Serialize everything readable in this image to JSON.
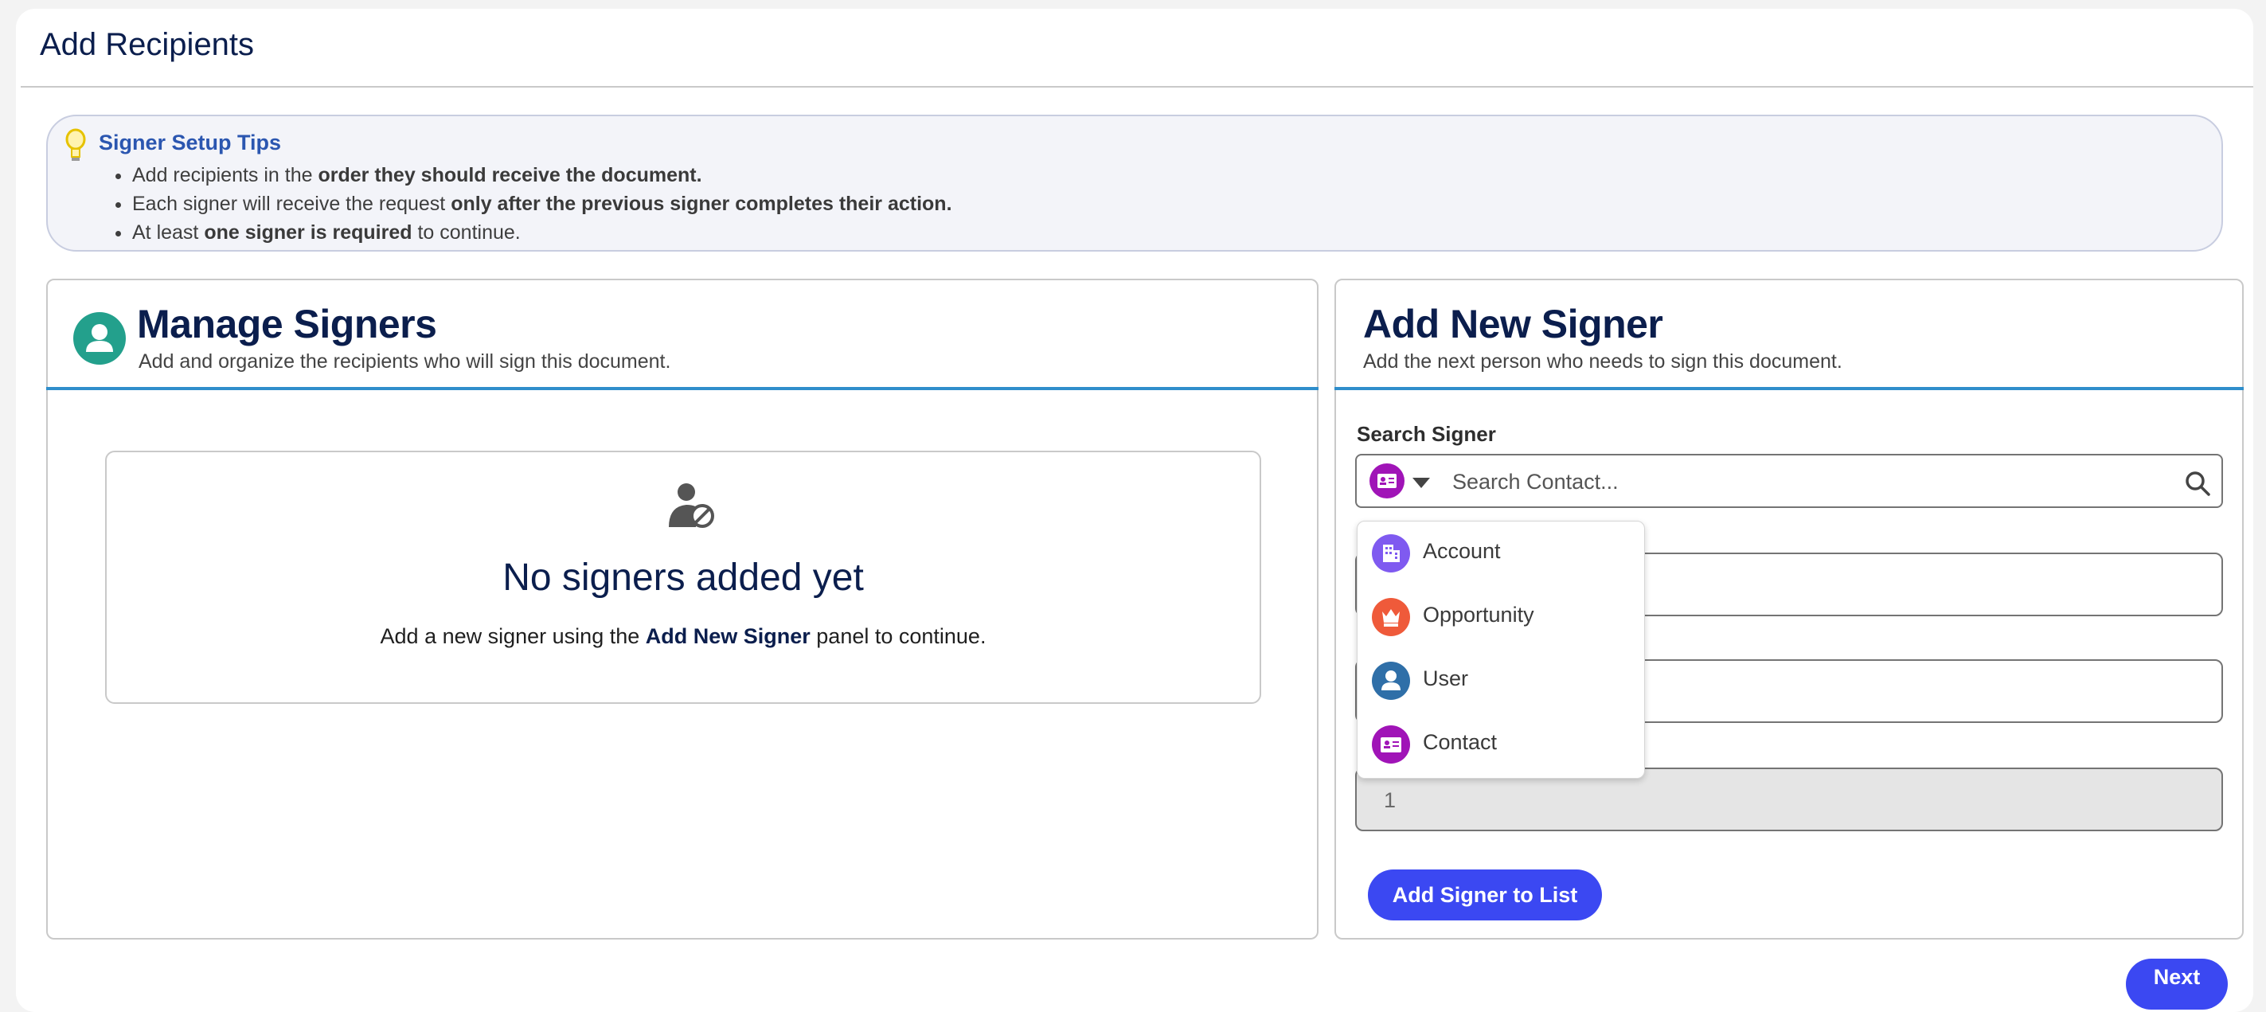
{
  "page": {
    "title": "Add Recipients"
  },
  "tips": {
    "title": "Signer Setup Tips",
    "items": [
      {
        "pre": "Add recipients in the ",
        "bold": "order they should receive the document.",
        "post": ""
      },
      {
        "pre": "Each signer will receive the request ",
        "bold": "only after the previous signer completes their action.",
        "post": ""
      },
      {
        "pre": "At least ",
        "bold": "one signer is required",
        "post": " to continue."
      }
    ]
  },
  "manage": {
    "title": "Manage Signers",
    "subtitle": "Add and organize the recipients who will sign this document.",
    "empty_title": "No signers added yet",
    "empty_pre": "Add a new signer using the ",
    "empty_bold": "Add New Signer",
    "empty_post": " panel to continue."
  },
  "add": {
    "title": "Add New Signer",
    "subtitle": "Add the next person who needs to sign this document.",
    "search_label": "Search Signer",
    "search_placeholder": "Search Contact...",
    "order_value": "1",
    "add_button": "Add Signer to List"
  },
  "dropdown": {
    "items": [
      {
        "label": "Account",
        "icon": "account-icon",
        "color": "#7f5af0"
      },
      {
        "label": "Opportunity",
        "icon": "opportunity-icon",
        "color": "#ef5a3a"
      },
      {
        "label": "User",
        "icon": "user-icon",
        "color": "#2f6fa8"
      },
      {
        "label": "Contact",
        "icon": "contact-icon",
        "color": "#a014b7"
      }
    ]
  },
  "footer": {
    "next_button": "Next"
  },
  "colors": {
    "accent": "#3b48f2",
    "rule": "#2f8ecb",
    "navy": "#0b1e4d"
  }
}
